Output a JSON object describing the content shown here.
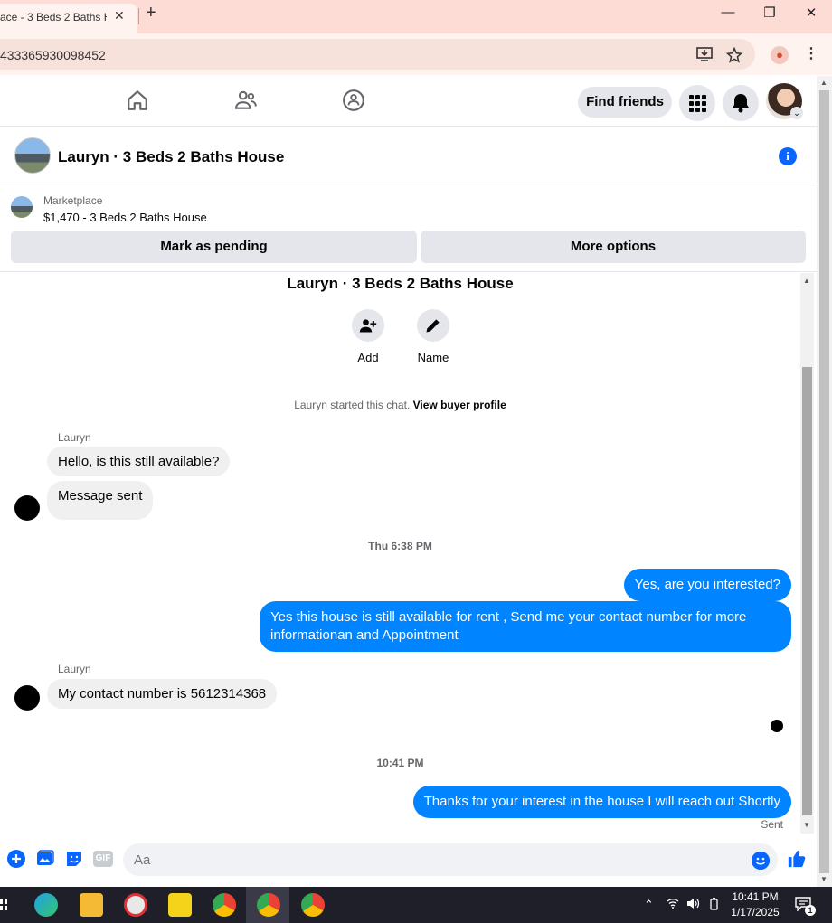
{
  "browser": {
    "tab_title": "ace - 3 Beds 2 Baths H",
    "tab_close": "✕",
    "new_tab": "+",
    "url": "433365930098452",
    "minimize": "—",
    "restore": "❐",
    "close": "✕"
  },
  "fbnav": {
    "find_friends": "Find friends"
  },
  "chat": {
    "title": "Lauryn · 3 Beds 2 Baths House",
    "info": "i"
  },
  "marketplace": {
    "label": "Marketplace",
    "item": "$1,470 - 3 Beds 2 Baths House",
    "mark_pending": "Mark as pending",
    "more_options": "More options"
  },
  "conversation": {
    "name": "Lauryn · 3 Beds 2 Baths House",
    "add_label": "Add",
    "name_label": "Name",
    "started_text": "Lauryn started this chat.",
    "view_profile": "View buyer profile",
    "sender1": "Lauryn",
    "msg1": "Hello, is this still available?",
    "msg2": "Message sent",
    "ts1": "Thu 6:38 PM",
    "out1": "Yes, are you interested?",
    "out2": "Yes this house is still available for rent , Send me your contact number for more informationan and Appointment",
    "sender2": "Lauryn",
    "msg3": "My contact number is 5612314368",
    "ts2": "10:41 PM",
    "out3": "Thanks for your interest in the house I will reach out Shortly",
    "status": "Sent"
  },
  "composer": {
    "placeholder": "Aa",
    "gif": "GIF"
  },
  "taskbar": {
    "time": "10:41 PM",
    "date": "1/17/2025",
    "notif_count": "1"
  },
  "colors": {
    "messenger_blue": "#0084ff",
    "fb_blue": "#0866ff",
    "tab_bg": "#fcdcd4"
  }
}
